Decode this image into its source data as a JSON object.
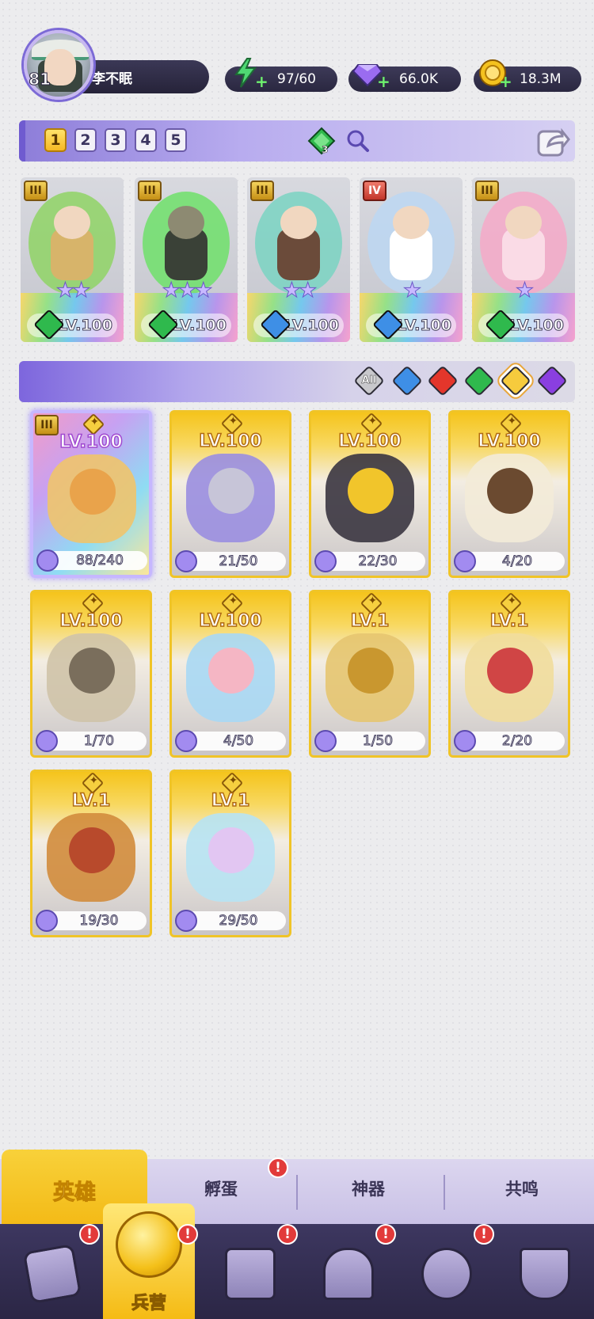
{
  "player": {
    "level": "81",
    "name": "李不眠"
  },
  "resources": [
    {
      "name": "energy",
      "icon": "lightning-icon",
      "value": "97/60",
      "color": "#4fd873"
    },
    {
      "name": "gems",
      "icon": "gem-icon",
      "value": "66.0K",
      "color": "#9a6cf0"
    },
    {
      "name": "gold",
      "icon": "coin-icon",
      "value": "18.3M",
      "color": "#f4c21f"
    }
  ],
  "team": {
    "tabs": [
      "1",
      "2",
      "3",
      "4",
      "5"
    ],
    "active_tab": "1",
    "element_badge": "3",
    "heroes": [
      {
        "rank": "III",
        "stars": "★★",
        "level": "LV.100",
        "element": "nature",
        "glow": "#8fd465",
        "body": "#d7b46a"
      },
      {
        "rank": "III",
        "stars": "★★★",
        "level": "LV.100",
        "element": "nature",
        "glow": "#6ee06a",
        "body": "#3a4137"
      },
      {
        "rank": "III",
        "stars": "★★",
        "level": "LV.100",
        "element": "water",
        "glow": "#7ad3c2",
        "body": "#6b4b3a"
      },
      {
        "rank": "IV",
        "stars": "★",
        "level": "LV.100",
        "element": "water",
        "glow": "#bcd7f2",
        "body": "#ffffff"
      },
      {
        "rank": "III",
        "stars": "★",
        "level": "LV.100",
        "element": "nature",
        "glow": "#f6a9c8",
        "body": "#fadbe6"
      }
    ]
  },
  "filter": {
    "options": [
      {
        "name": "all",
        "label": "All",
        "color": "#c8c8cc"
      },
      {
        "name": "water",
        "label": "",
        "color": "#3e8fe6"
      },
      {
        "name": "fire",
        "label": "",
        "color": "#e4362b"
      },
      {
        "name": "nature",
        "label": "",
        "color": "#2fb94d"
      },
      {
        "name": "light",
        "label": "",
        "color": "#f6cb3d"
      },
      {
        "name": "dark",
        "label": "",
        "color": "#8a3fe0"
      }
    ],
    "selected": "light"
  },
  "collection": [
    {
      "level": "LV.100",
      "progress": "88/240",
      "rank": "III",
      "art": "#f0c46c",
      "art2": "#e9a34b"
    },
    {
      "level": "LV.100",
      "progress": "21/50",
      "art": "#9a8ee0",
      "art2": "#c7c5d8"
    },
    {
      "level": "LV.100",
      "progress": "22/30",
      "art": "#3a3540",
      "art2": "#f1c52b"
    },
    {
      "level": "LV.100",
      "progress": "4/20",
      "art": "#f3ebd8",
      "art2": "#6b4a30"
    },
    {
      "level": "LV.100",
      "progress": "1/70",
      "art": "#cfc3a8",
      "art2": "#7a6e5c"
    },
    {
      "level": "LV.100",
      "progress": "4/50",
      "art": "#a8d8f4",
      "art2": "#f5b6c4"
    },
    {
      "level": "LV.1",
      "progress": "1/50",
      "art": "#e6c570",
      "art2": "#c9972f"
    },
    {
      "level": "LV.1",
      "progress": "2/20",
      "art": "#f1dd9c",
      "art2": "#d04545"
    },
    {
      "level": "LV.1",
      "progress": "19/30",
      "art": "#d28c3c",
      "art2": "#b84a2c"
    },
    {
      "level": "LV.1",
      "progress": "29/50",
      "art": "#b7e3f3",
      "art2": "#e2c6f2"
    }
  ],
  "sub_tabs": {
    "active": "英雄",
    "others": [
      "孵蛋",
      "神器",
      "共鸣"
    ],
    "badge": "!"
  },
  "nav": {
    "active_label": "兵营",
    "badge": "!"
  }
}
